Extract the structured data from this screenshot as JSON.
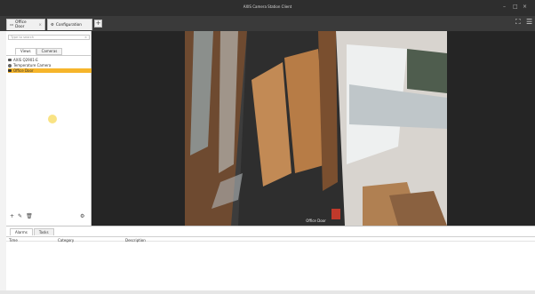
{
  "window": {
    "title": "AXIS Camera Station Client"
  },
  "tabs": [
    {
      "label": "Office Door",
      "active": true
    },
    {
      "label": "Configuration",
      "active": false
    }
  ],
  "sidebar": {
    "search_placeholder": "Type to search",
    "view_tabs": [
      "Views",
      "Cameras"
    ],
    "items": [
      {
        "label": "AXIS Q2901-E",
        "icon": "camera-icon",
        "selected": false
      },
      {
        "label": "Temperature Camera",
        "icon": "thermometer-icon",
        "selected": false
      },
      {
        "label": "Office Door",
        "icon": "camera-icon",
        "selected": true
      }
    ]
  },
  "video": {
    "camera_name": "Office Door"
  },
  "bottom_panel": {
    "tabs": [
      "Alarms",
      "Tasks"
    ],
    "columns": [
      "Time",
      "Category",
      "Description"
    ]
  },
  "colors": {
    "accent": "#f6b52b",
    "titlebar": "#2e2e2e",
    "tabbar": "#3a3a3a",
    "video_bg": "#252525"
  }
}
